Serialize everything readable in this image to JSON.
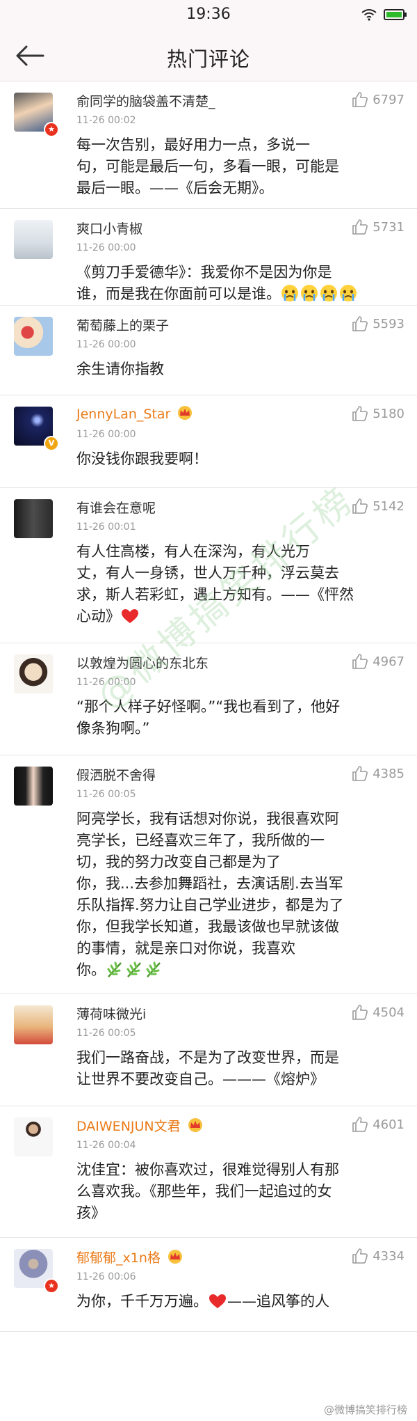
{
  "status_bar": {
    "time": "19:36",
    "icons": [
      "wifi-icon",
      "battery-icon"
    ]
  },
  "nav": {
    "back_icon": "arrow-left-icon",
    "title": "热门评论"
  },
  "colors": {
    "vip_name": "#ea7b19",
    "like_count": "#9a9a9a",
    "badge_red": "#e8321f",
    "badge_yellow": "#f0a613",
    "heart": "#e82a2a",
    "watermark": "#96cd96"
  },
  "comments": [
    {
      "user": "俞同学的脑袋盖不清楚_",
      "time": "11-26 00:02",
      "likes": "6797",
      "badge": "red",
      "vip": false,
      "text": [
        "每一次告别，最好用力一点，多说一",
        "句，可能是最后一句，多看一眼，可能是",
        "最后一眼。——《后会无期》。"
      ]
    },
    {
      "user": "爽口小青椒",
      "time": "11-26 00:00",
      "likes": "5731",
      "badge": "",
      "vip": false,
      "text": [
        "《剪刀手爱德华》：我爱你不是因为你是",
        "谁，而是我在你面前可以是谁。"
      ],
      "emoji": [
        "crying-face-icon",
        "crying-face-icon",
        "crying-face-icon",
        "crying-face-icon"
      ]
    },
    {
      "user": "葡萄藤上的栗子",
      "time": "11-26 00:00",
      "likes": "5593",
      "badge": "",
      "vip": false,
      "text": [
        "余生请你指教"
      ]
    },
    {
      "user": "JennyLan_Star",
      "time": "11-26 00:00",
      "likes": "5180",
      "badge": "yellow",
      "vip": true,
      "text": [
        "你没钱你跟我要啊！"
      ]
    },
    {
      "user": "有谁会在意呢",
      "time": "11-26 00:01",
      "likes": "5142",
      "badge": "",
      "vip": false,
      "text": [
        "有人住高楼，有人在深沟，有人光万",
        "丈，有人一身锈，世人万千种，浮云莫去",
        "求，斯人若彩虹，遇上方知有。——《怦然",
        "心动》"
      ],
      "emoji": [
        "heart-icon"
      ]
    },
    {
      "user": "以敦煌为圆心的东北东",
      "time": "11-26 00:00",
      "likes": "4967",
      "badge": "",
      "vip": false,
      "text": [
        "“那个人样子好怪啊。”“我也看到了，他好",
        "像条狗啊。”"
      ]
    },
    {
      "user": "假洒脱不舍得",
      "time": "11-26 00:05",
      "likes": "4385",
      "badge": "",
      "vip": false,
      "text": [
        "阿亮学长，我有话想对你说，我很喜欢阿",
        "亮学长，已经喜欢三年了，我所做的一",
        "切，我的努力改变自己都是为了",
        "你，我...去参加舞蹈社，去演话剧.去当军",
        "乐队指挥.努力让自己学业进步，都是为了",
        "你，但我学长知道，我最该做也早就该做",
        "的事情，就是亲口对你说，我喜欢",
        "你。"
      ],
      "emoji": [
        "plant-icon",
        "plant-icon",
        "plant-icon"
      ]
    },
    {
      "user": "薄荷味微光i",
      "time": "11-26 00:05",
      "likes": "4504",
      "badge": "",
      "vip": false,
      "text": [
        "我们一路奋战，不是为了改变世界，而是",
        "让世界不要改变自己。———《熔炉》"
      ]
    },
    {
      "user": "DAIWENJUN文君",
      "time": "11-26 00:04",
      "likes": "4601",
      "badge": "",
      "vip": true,
      "text": [
        "沈佳宜：被你喜欢过，很难觉得别人有那",
        "么喜欢我。《那些年，我们一起追过的女",
        "孩》"
      ]
    },
    {
      "user": "郁郁郁_x1n格",
      "time": "11-26 00:06",
      "likes": "4334",
      "badge": "red",
      "vip": true,
      "text": [
        "为你，千千万万遍。——追风筝的人"
      ],
      "emoji_before": [
        "heart-icon"
      ]
    }
  ],
  "watermark": "@微博搞笑排行榜",
  "footer_mark": "@微博搞笑排行榜"
}
